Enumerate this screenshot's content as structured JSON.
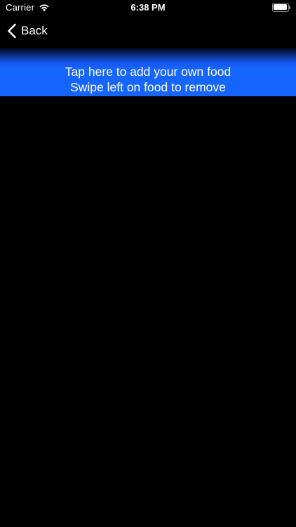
{
  "status_bar": {
    "carrier": "Carrier",
    "time": "6:38 PM",
    "wifi_icon": "wifi-icon",
    "battery_icon": "battery-icon",
    "battery_level": 1.0
  },
  "nav": {
    "back_label": "Back",
    "back_icon": "chevron-left-icon"
  },
  "banner": {
    "line1": "Tap here to add your own food",
    "line2": "Swipe left on food to remove",
    "accent_color": "#1765ff"
  },
  "food_list": {
    "items": []
  }
}
